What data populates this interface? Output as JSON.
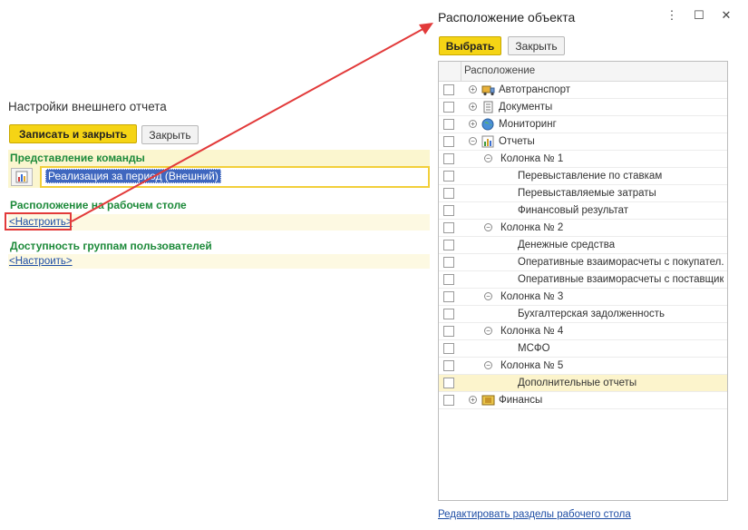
{
  "left": {
    "title": "Настройки внешнего отчета",
    "save_close": "Записать и закрыть",
    "close": "Закрыть",
    "section_command": "Представление команды",
    "command_value": "Реализация за период (Внешний)",
    "section_desktop": "Расположение на рабочем столе",
    "configure1": "<Настроить>",
    "section_access": "Доступность группам пользователей",
    "configure2": "<Настроить>"
  },
  "dialog": {
    "title": "Расположение объекта",
    "select": "Выбрать",
    "close": "Закрыть",
    "column_header": "Расположение",
    "edit_link": "Редактировать разделы рабочего стола",
    "rows": [
      {
        "label": "Автотранспорт",
        "level": 0,
        "expander": "plus",
        "icon": "truck-icon"
      },
      {
        "label": "Документы",
        "level": 0,
        "expander": "plus",
        "icon": "document-icon"
      },
      {
        "label": "Мониторинг",
        "level": 0,
        "expander": "plus",
        "icon": "globe-icon"
      },
      {
        "label": "Отчеты",
        "level": 0,
        "expander": "minus",
        "icon": "report-icon"
      },
      {
        "label": "Колонка № 1",
        "level": 1,
        "expander": "minus"
      },
      {
        "label": "Перевыставление по ставкам",
        "level": 2
      },
      {
        "label": "Перевыставляемые затраты",
        "level": 2
      },
      {
        "label": "Финансовый результат",
        "level": 2
      },
      {
        "label": "Колонка № 2",
        "level": 1,
        "expander": "minus"
      },
      {
        "label": "Денежные средства",
        "level": 2
      },
      {
        "label": "Оперативные взаиморасчеты с покупател...",
        "level": 2
      },
      {
        "label": "Оперативные взаиморасчеты с поставщик...",
        "level": 2
      },
      {
        "label": "Колонка № 3",
        "level": 1,
        "expander": "minus"
      },
      {
        "label": "Бухгалтерская задолженность",
        "level": 2
      },
      {
        "label": "Колонка № 4",
        "level": 1,
        "expander": "minus"
      },
      {
        "label": "МСФО",
        "level": 2
      },
      {
        "label": "Колонка № 5",
        "level": 1,
        "expander": "minus"
      },
      {
        "label": "Дополнительные отчеты",
        "level": 2,
        "selected": true
      },
      {
        "label": "Финансы",
        "level": 0,
        "expander": "plus",
        "icon": "finance-icon"
      }
    ]
  },
  "colors": {
    "accent": "#f5d415",
    "section": "#1d8a3a",
    "arrow": "#e23a3a",
    "link": "#1f4ea5"
  }
}
